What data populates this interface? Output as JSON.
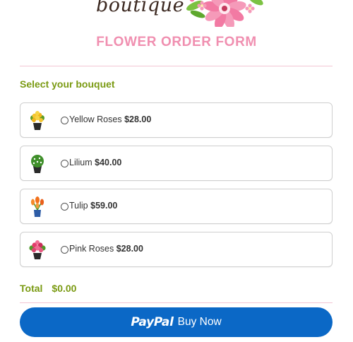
{
  "header": {
    "brand_word": "boutique",
    "title": "FLOWER ORDER FORM"
  },
  "form": {
    "section_label": "Select your bouquet",
    "options": [
      {
        "name": "Yellow Roses",
        "price": "$28.00",
        "selected": false,
        "icon": "yellow-roses-bouquet-icon"
      },
      {
        "name": "Lilium",
        "price": "$40.00",
        "selected": false,
        "icon": "lilium-bouquet-icon"
      },
      {
        "name": "Tulip",
        "price": "$59.00",
        "selected": false,
        "icon": "tulip-bouquet-icon"
      },
      {
        "name": "Pink Roses",
        "price": "$28.00",
        "selected": false,
        "icon": "pink-roses-bouquet-icon"
      }
    ],
    "total_label": "Total",
    "total_value": "$0.00"
  },
  "pay_button": {
    "brand": "PayPal",
    "label": "Buy Now"
  },
  "colors": {
    "title_pink": "#f08fb0",
    "accent_green": "#7a9a12",
    "button_blue": "#0b68c6"
  }
}
